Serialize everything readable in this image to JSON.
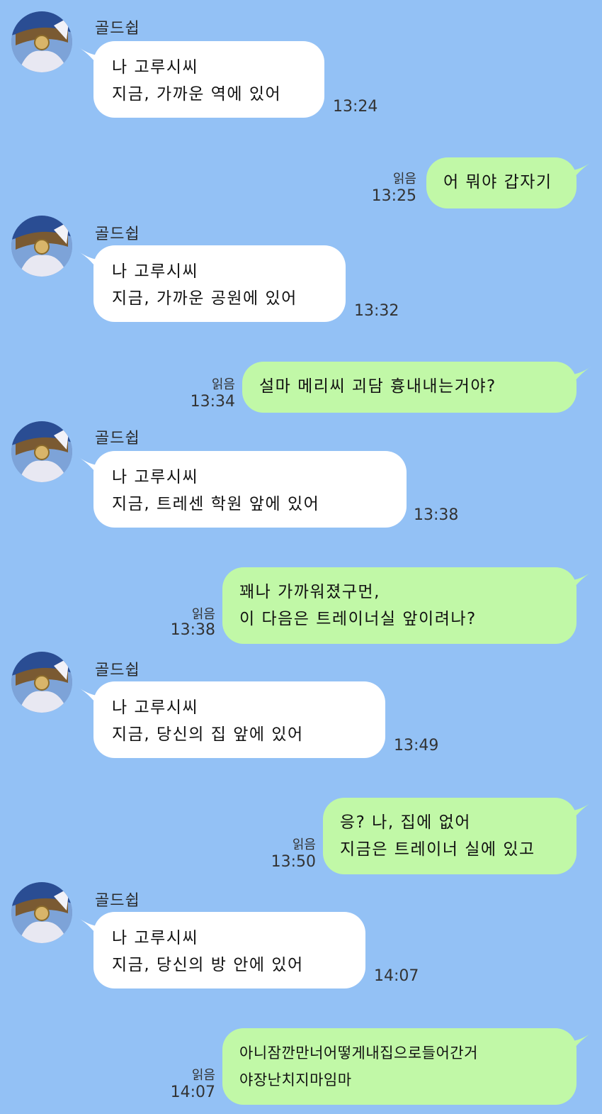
{
  "colors": {
    "background": "#93c1f5",
    "incoming_bubble": "#ffffff",
    "outgoing_bubble": "#c1f8a7"
  },
  "sender_name": "골드쉽",
  "messages": [
    {
      "dir": "in",
      "lines": [
        "나 고루시씨",
        "지금, 가까운 역에 있어"
      ],
      "time": "13:24"
    },
    {
      "dir": "out",
      "lines": [
        "어 뭐야 갑자기"
      ],
      "read": "읽음",
      "time": "13:25"
    },
    {
      "dir": "in",
      "lines": [
        "나 고루시씨",
        "지금, 가까운 공원에 있어"
      ],
      "time": "13:32"
    },
    {
      "dir": "out",
      "lines": [
        "설마 메리씨 괴담 흉내내는거야?"
      ],
      "read": "읽음",
      "time": "13:34"
    },
    {
      "dir": "in",
      "lines": [
        "나 고루시씨",
        "지금, 트레센 학원 앞에 있어"
      ],
      "time": "13:38"
    },
    {
      "dir": "out",
      "lines": [
        "꽤나 가까워졌구먼,",
        "이 다음은 트레이너실 앞이려나?"
      ],
      "read": "읽음",
      "time": "13:38"
    },
    {
      "dir": "in",
      "lines": [
        "나 고루시씨",
        "지금, 당신의 집 앞에 있어"
      ],
      "time": "13:49"
    },
    {
      "dir": "out",
      "lines": [
        "응? 나, 집에 없어",
        "지금은 트레이너 실에 있고"
      ],
      "read": "읽음",
      "time": "13:50"
    },
    {
      "dir": "in",
      "lines": [
        "나 고루시씨",
        "지금, 당신의 방 안에 있어"
      ],
      "time": "14:07"
    },
    {
      "dir": "out",
      "lines": [
        "아니잠깐만너어떻게내집으로들어간거",
        "야장난치지마임마"
      ],
      "read": "읽음",
      "time": "14:07"
    }
  ]
}
